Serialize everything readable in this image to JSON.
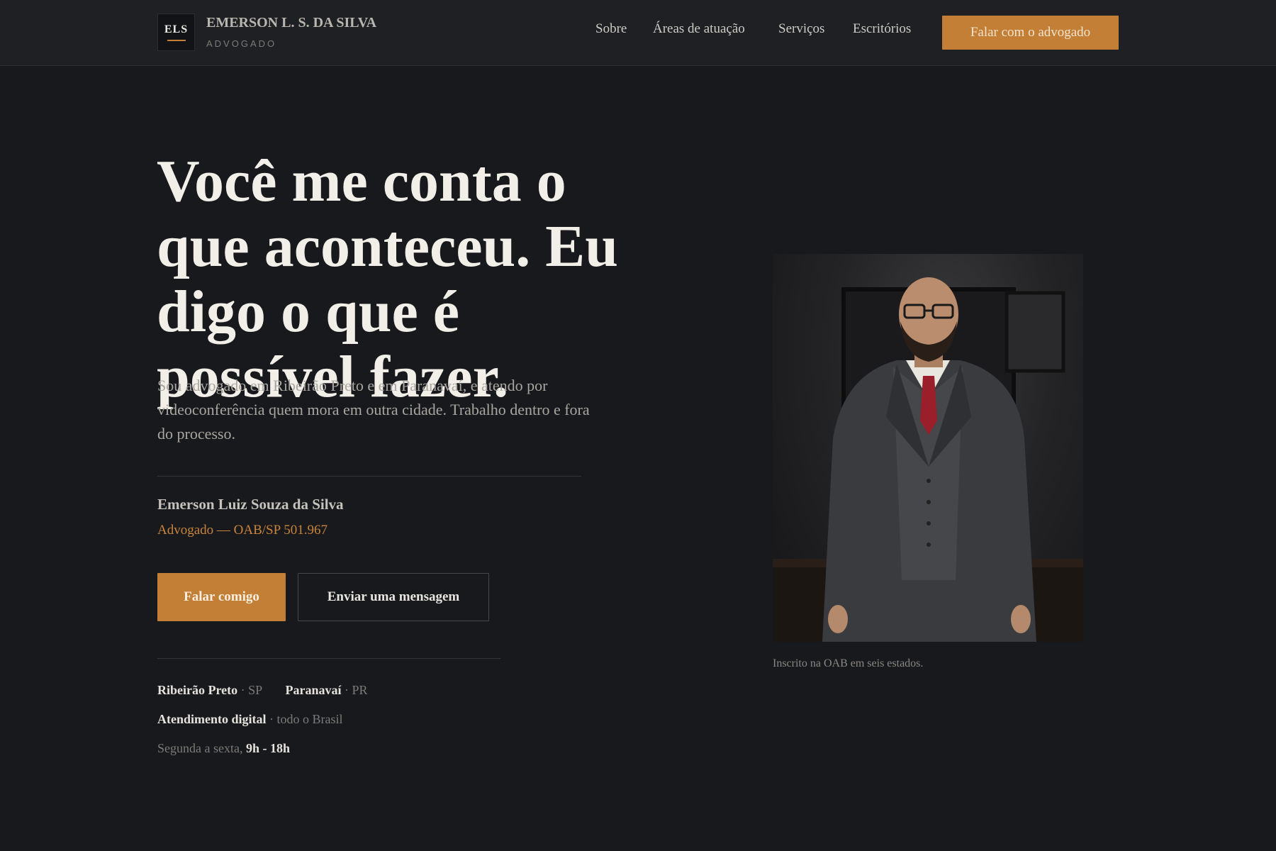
{
  "header": {
    "logo_monogram": "ELS",
    "brand_name": "EMERSON L. S. DA SILVA",
    "brand_subtitle": "ADVOGADO",
    "nav": [
      "Sobre",
      "Áreas de atuação",
      "Serviços",
      "Escritórios"
    ],
    "cta_label": "Falar com o advogado"
  },
  "hero": {
    "headline": "Você me conta o que aconteceu. Eu digo o que é possível fazer.",
    "intro": "Sou advogado em Ribeirão Preto e em Paranavaí, e atendo por videoconferência quem mora em outra cidade. Trabalho dentro e fora do processo.",
    "name": "Emerson Luiz Souza da Silva",
    "role": "Advogado — OAB/SP 501.967",
    "primary_button": "Falar comigo",
    "secondary_button": "Enviar uma mensagem"
  },
  "locations": {
    "city1": "Ribeirão Preto",
    "state1": "· SP",
    "city2": "Paranavaí",
    "state2": "· PR",
    "digital": "Atendimento digital",
    "digital_scope": "· todo o Brasil",
    "hours_prefix": "Segunda a sexta,",
    "hours": "9h - 18h"
  },
  "photo": {
    "caption": "Inscrito na OAB em seis estados."
  },
  "colors": {
    "background": "#18191d",
    "header": "#1f2024",
    "accent": "#c27f35"
  }
}
